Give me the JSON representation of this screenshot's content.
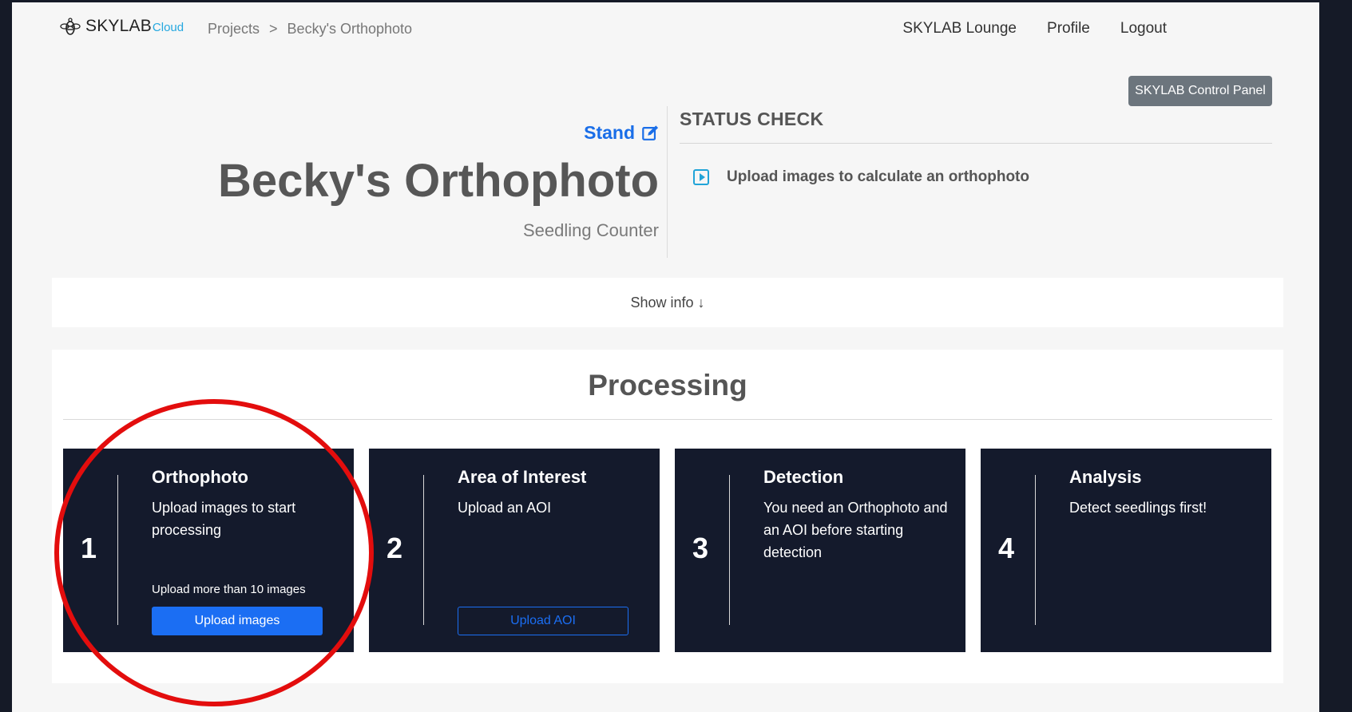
{
  "nav": {
    "brand_main": "SKYLAB",
    "brand_sub": "Cloud",
    "breadcrumb": [
      "Projects",
      "Becky's Orthophoto"
    ],
    "breadcrumb_sep": ">",
    "links": [
      "SKYLAB Lounge",
      "Profile",
      "Logout"
    ]
  },
  "control_panel_label": "SKYLAB Control Panel",
  "project": {
    "type_label": "Stand",
    "title": "Becky's Orthophoto",
    "subtitle": "Seedling Counter"
  },
  "status": {
    "heading": "STATUS CHECK",
    "message": "Upload images to calculate an orthophoto"
  },
  "show_info_label": "Show info ↓",
  "processing": {
    "heading": "Processing",
    "steps": [
      {
        "number": "1",
        "title": "Orthophoto",
        "description": "Upload images to start processing",
        "note": "Upload more than 10 images",
        "button": "Upload images"
      },
      {
        "number": "2",
        "title": "Area of Interest",
        "description": "Upload an AOI",
        "button": "Upload AOI"
      },
      {
        "number": "3",
        "title": "Detection",
        "description": "You need an Orthophoto and an AOI before starting detection"
      },
      {
        "number": "4",
        "title": "Analysis",
        "description": "Detect seedlings first!"
      }
    ]
  },
  "colors": {
    "accent": "#1b6ef3",
    "card_bg": "#141a2c",
    "annotation": "#e30d0d"
  }
}
